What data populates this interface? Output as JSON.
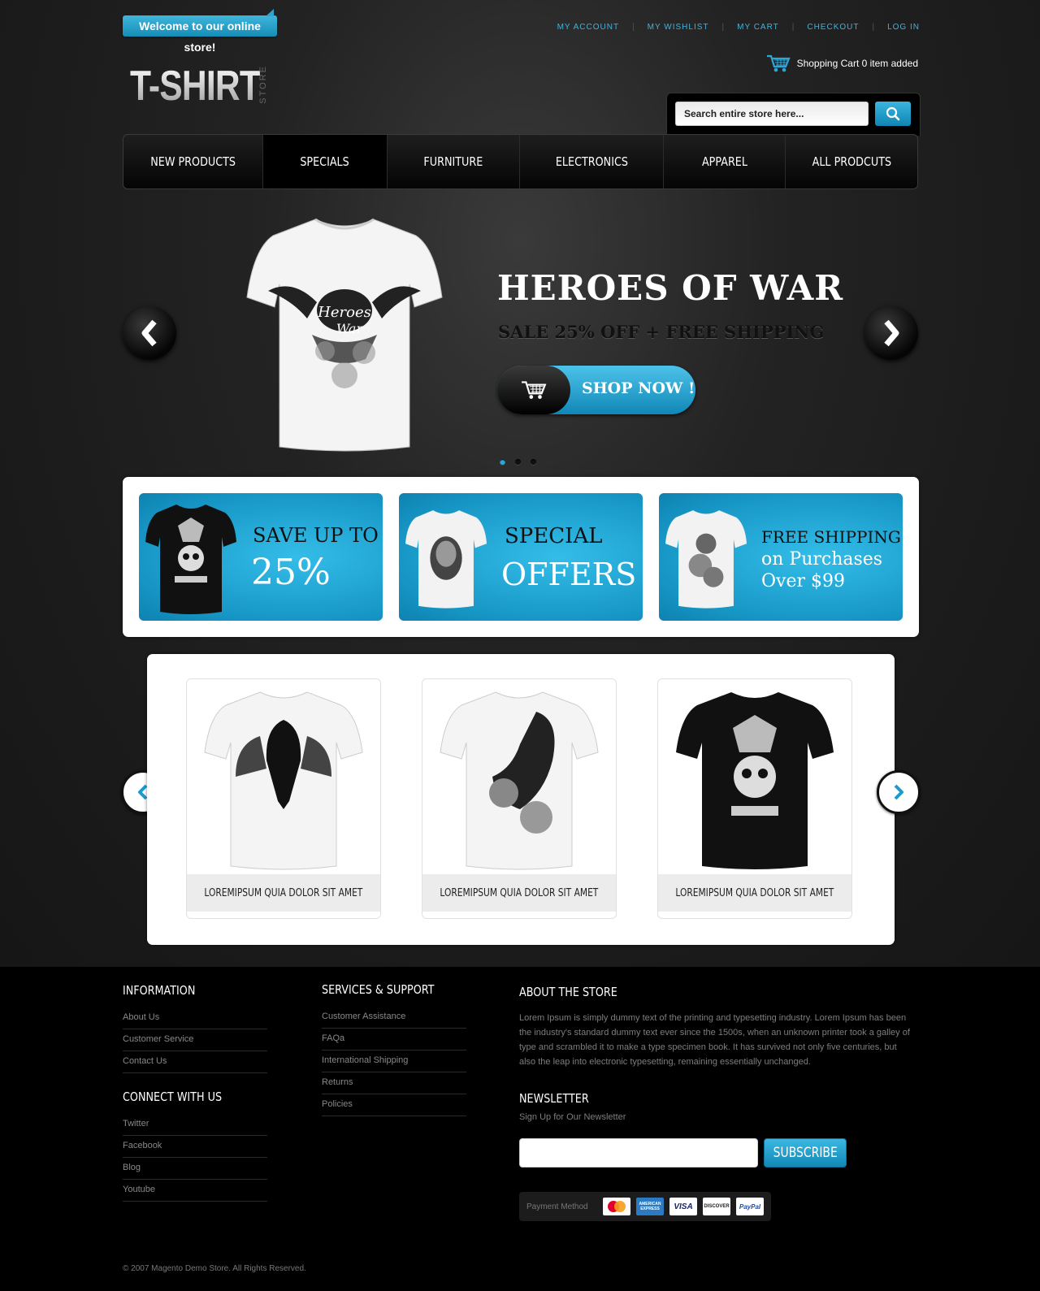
{
  "header": {
    "welcome": "Welcome to our online store!",
    "top_links": [
      "MY ACCOUNT",
      "MY WISHLIST",
      "MY CART",
      "CHECKOUT",
      "LOG IN"
    ],
    "logo_main": "T-SHIRT",
    "logo_sub": "STORE",
    "cart_text": "Shopping Cart 0 item added",
    "search_placeholder": "Search entire store here..."
  },
  "nav": {
    "items": [
      "NEW PRODUCTS",
      "SPECIALS",
      "FURNITURE",
      "ELECTRONICS",
      "APPAREL",
      "ALL PRODCUTS"
    ],
    "active": "SPECIALS"
  },
  "hero": {
    "title": "HEROES OF WAR",
    "subtitle": "SALE 25% OFF + FREE SHIPPING",
    "button": "SHOP NOW !",
    "slides": 3,
    "active_slide": 1
  },
  "promos": [
    {
      "line1": "SAVE UP TO",
      "line2": "25%"
    },
    {
      "line1": "SPECIAL",
      "line2": "OFFERS"
    },
    {
      "line1": "FREE SHIPPING",
      "line2": "on Purchases",
      "line3": "Over $99"
    }
  ],
  "products": [
    {
      "caption": "LOREMIPSUM QUIA DOLOR SIT AMET"
    },
    {
      "caption": "LOREMIPSUM QUIA DOLOR SIT AMET"
    },
    {
      "caption": "LOREMIPSUM QUIA DOLOR SIT AMET"
    }
  ],
  "footer": {
    "information": {
      "title": "INFORMATION",
      "links": [
        "About Us",
        "Customer Service",
        "Contact Us"
      ]
    },
    "connect": {
      "title": "CONNECT WITH US",
      "links": [
        "Twitter",
        "Facebook",
        "Blog",
        "Youtube"
      ]
    },
    "services": {
      "title": "SERVICES & SUPPORT",
      "links": [
        "Customer Assistance",
        "FAQa",
        "International Shipping",
        "Returns",
        "Policies"
      ]
    },
    "about": {
      "title": "ABOUT THE STORE",
      "text": "Lorem Ipsum is simply dummy text of the printing and typesetting industry. Lorem Ipsum has been the industry's standard dummy text ever since the 1500s, when an unknown printer took a galley of type and scrambled it to make a type specimen book. It has survived not only five centuries, but also the leap into electronic typesetting, remaining essentially unchanged."
    },
    "newsletter": {
      "title": "NEWSLETTER",
      "subtitle": "Sign Up for Our Newsletter",
      "button": "SUBSCRIBE"
    },
    "payment": {
      "label": "Payment Method",
      "cards": [
        "MasterCard",
        "AMERICAN EXPRESS",
        "VISA",
        "DISCOVER",
        "PayPal"
      ]
    },
    "copyright": "© 2007 Magento Demo Store. All Rights Reserved."
  },
  "colors": {
    "accent": "#1ea0cf",
    "background": "#1c1c1c",
    "footer": "#000000"
  }
}
